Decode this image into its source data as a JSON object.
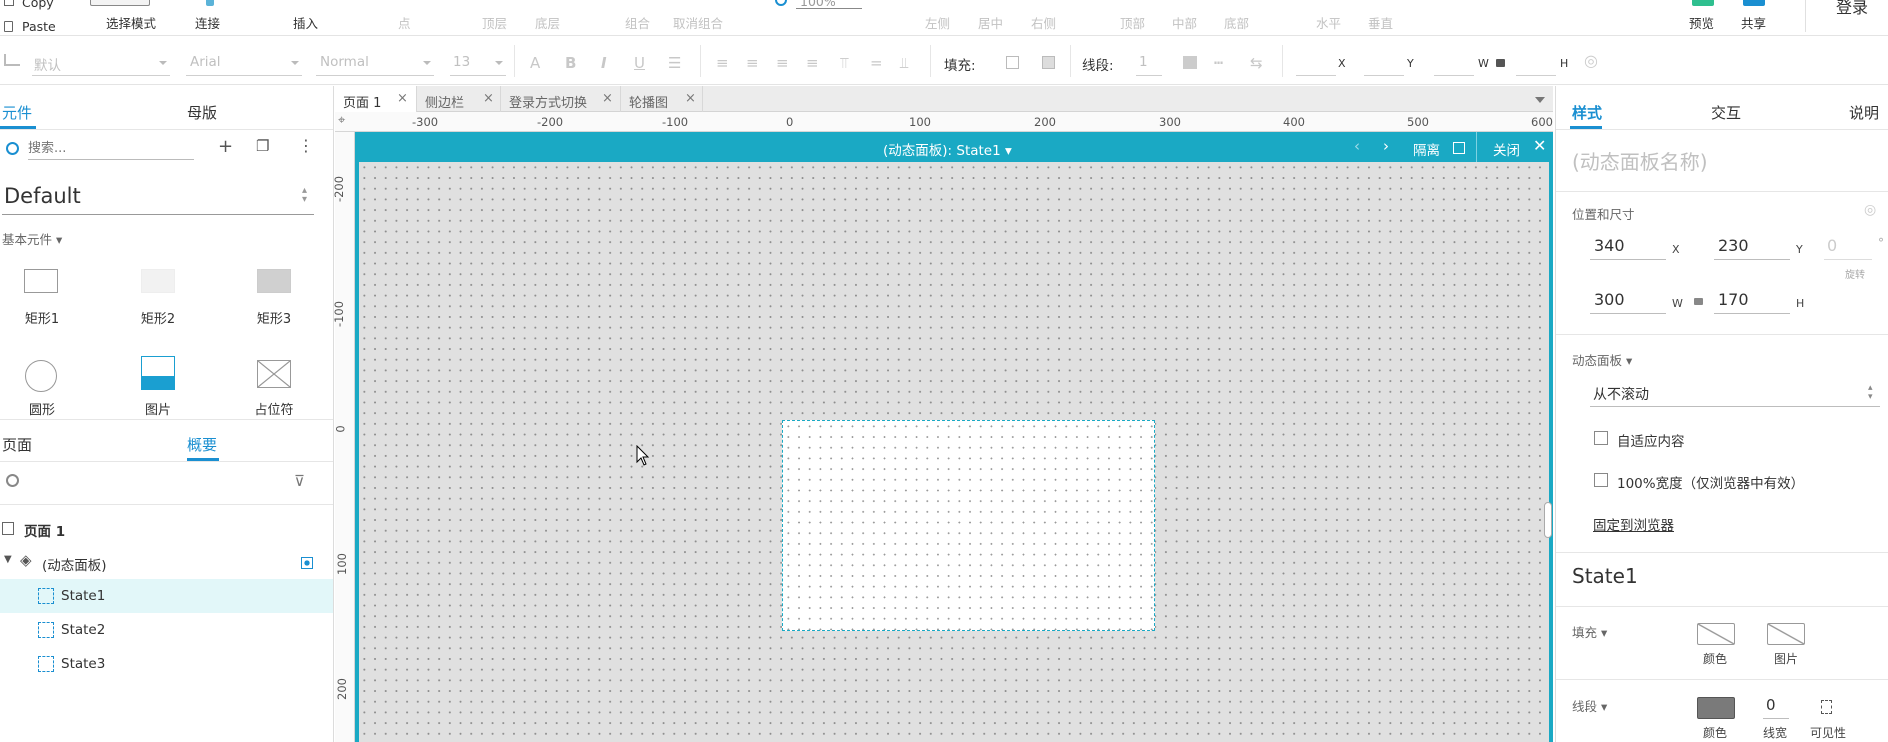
{
  "toolbar": {
    "copy": "Copy",
    "paste": "Paste",
    "select_mode": "选择模式",
    "connect": "连接",
    "insert": "插入",
    "point": "点",
    "top_layer": "顶层",
    "bottom_layer": "底层",
    "group": "组合",
    "ungroup": "取消组合",
    "zoom_value": "100%",
    "align_left": "左侧",
    "align_center": "居中",
    "align_right": "右侧",
    "align_top": "顶部",
    "align_middle": "中部",
    "align_bottom": "底部",
    "distribute_h": "水平",
    "distribute_v": "垂直",
    "preview": "预览",
    "share": "共享",
    "login": "登录"
  },
  "format": {
    "style_default": "默认",
    "font_family": "Arial",
    "font_weight": "Normal",
    "font_size": "13",
    "fill_label": "填充:",
    "stroke_label": "线段:",
    "stroke_value": "1",
    "x_label": "X",
    "y_label": "Y",
    "w_label": "W",
    "h_label": "H"
  },
  "left": {
    "tab_widgets": "元件",
    "tab_masters": "母版",
    "search_placeholder": "搜索...",
    "library": "Default",
    "group_basic": "基本元件 ▾",
    "widgets": [
      "矩形1",
      "矩形2",
      "矩形3",
      "圆形",
      "图片",
      "占位符"
    ],
    "tab_pages": "页面",
    "tab_outline": "概要",
    "tree": {
      "page": "页面 1",
      "panel": "(动态面板)",
      "states": [
        "State1",
        "State2",
        "State3"
      ]
    }
  },
  "doc_tabs": [
    "页面 1",
    "侧边栏",
    "登录方式切换",
    "轮播图"
  ],
  "ruler": {
    "h": [
      "-300",
      "-200",
      "-100",
      "0",
      "100",
      "200",
      "300",
      "400",
      "500",
      "600"
    ],
    "v": [
      "-200",
      "-100",
      "0",
      "100",
      "200"
    ]
  },
  "panel_header": {
    "title": "(动态面板):  State1 ▾",
    "isolate": "隔离",
    "close": "关闭"
  },
  "right": {
    "tab_style": "样式",
    "tab_interact": "交互",
    "tab_notes": "说明",
    "name_placeholder": "(动态面板名称)",
    "pos_size_label": "位置和尺寸",
    "x": "340",
    "y": "230",
    "rotation": "0",
    "w": "300",
    "h": "170",
    "x_unit": "X",
    "y_unit": "Y",
    "w_unit": "W",
    "h_unit": "H",
    "rot_unit": "°",
    "rot_label": "旋转",
    "dp_label": "动态面板 ▾",
    "scroll_option": "从不滚动",
    "fit_content": "自适应内容",
    "full_width": "100%宽度（仅浏览器中有效）",
    "pin_browser": "固定到浏览器",
    "state_name": "State1",
    "fill_label": "填充 ▾",
    "color": "颜色",
    "image": "图片",
    "stroke_label": "线段 ▾",
    "stroke_width": "0",
    "stroke_color": "颜色",
    "stroke_width_label": "线宽",
    "visibility": "可见性"
  },
  "colors": {
    "accent": "#1aa9c4",
    "active_tab": "#1a8fd1",
    "selected_row": "#e2f7f9"
  }
}
